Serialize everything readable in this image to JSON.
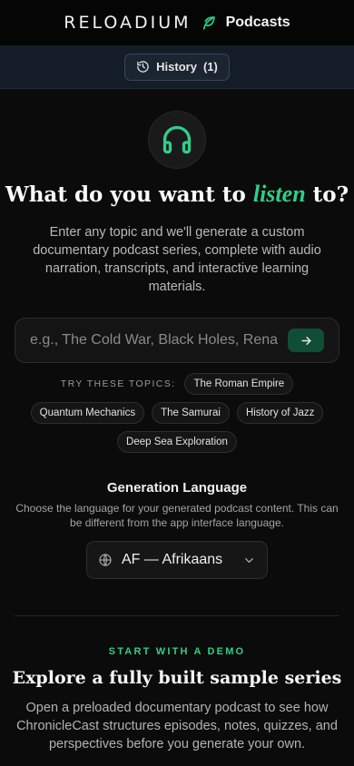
{
  "header": {
    "brand": "RELOADIUM",
    "product": "Podcasts"
  },
  "history": {
    "label": "History",
    "count": "(1)"
  },
  "hero": {
    "headline_before": "What do you want to ",
    "headline_accent": "listen",
    "headline_after": " to?",
    "description": "Enter any topic and we'll generate a custom documentary podcast series, complete with audio narration, transcripts, and interactive learning materials."
  },
  "search": {
    "placeholder": "e.g., The Cold War, Black Holes, Renaissance Art...",
    "value": ""
  },
  "topics": {
    "label": "TRY THESE TOPICS:",
    "items": [
      "The Roman Empire",
      "Quantum Mechanics",
      "The Samurai",
      "History of Jazz",
      "Deep Sea Exploration"
    ]
  },
  "language": {
    "title": "Generation Language",
    "description": "Choose the language for your generated podcast content. This can be different from the app interface language.",
    "selected": "AF — Afrikaans"
  },
  "demo": {
    "kicker": "START WITH A DEMO",
    "title": "Explore a fully built sample series",
    "description": "Open a preloaded documentary podcast to see how ChronicleCast structures episodes, notes, quizzes, and perspectives before you generate your own."
  },
  "colors": {
    "accent": "#2ecf8a",
    "background": "#0b0b0b",
    "subbar": "#141c27"
  },
  "icons": {
    "brand_mark": "leaf-icon",
    "history": "history-clock-icon",
    "hero": "headphones-icon",
    "submit": "arrow-right-icon",
    "language": "globe-icon",
    "dropdown": "chevron-down-icon"
  }
}
